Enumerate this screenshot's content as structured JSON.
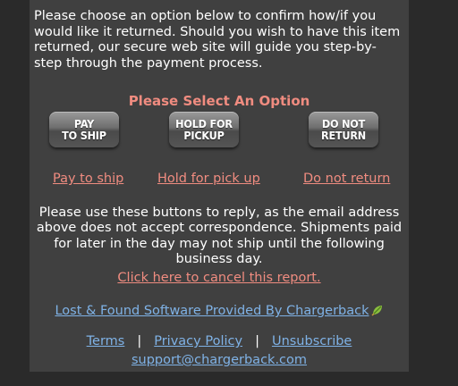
{
  "intro": {
    "text": "Please choose an option below to confirm how/if you would like it returned. Should you wish to have this item returned, our secure web site will guide you step-by-step through the payment process."
  },
  "options": {
    "title": "Please Select An Option",
    "buttons": [
      {
        "label": "PAY\nTO SHIP"
      },
      {
        "label": "HOLD FOR\nPICKUP"
      },
      {
        "label": "DO NOT\nRETURN"
      }
    ],
    "links": [
      {
        "label": "Pay to ship"
      },
      {
        "label": "Hold for pick up"
      },
      {
        "label": "Do not return"
      }
    ]
  },
  "notice": {
    "text": "Please use these buttons to reply, as the email address above does not accept correspondence. Shipments paid for later in the day may not ship until the following business day."
  },
  "cancel_link": "Click here to cancel this report.",
  "credit": {
    "text": "Lost & Found Software Provided By Chargerback",
    "icon": "chargerback-leaf-icon"
  },
  "footer": {
    "terms": "Terms",
    "privacy": "Privacy Policy",
    "unsubscribe": "Unsubscribe",
    "separator": "|",
    "support_email": "support@chargerback.com"
  },
  "colors": {
    "background": "#2a2a2a",
    "panel": "#404040",
    "accent": "#f08c80",
    "link": "#7fb2e6",
    "text": "#ffffff"
  }
}
